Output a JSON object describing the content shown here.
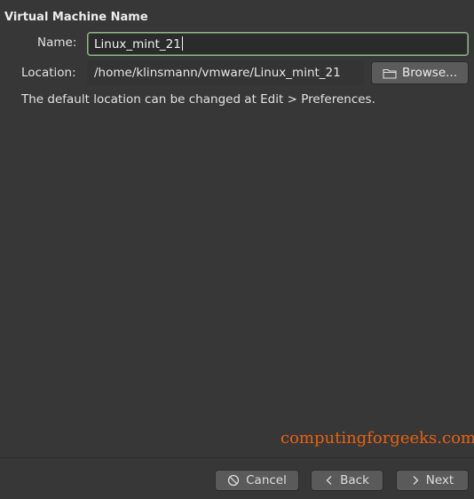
{
  "section": {
    "title": "Virtual Machine Name"
  },
  "name_row": {
    "label": "Name:",
    "value": "Linux_mint_21"
  },
  "location_row": {
    "label": "Location:",
    "value": "/home/klinsmann/vmware/Linux_mint_21",
    "browse_label": "Browse..."
  },
  "info": {
    "text": "The default location can be changed at Edit > Preferences."
  },
  "watermark": {
    "text": "computingforgeeks.com",
    "color": "#e8620f"
  },
  "footer": {
    "cancel_label": "Cancel",
    "back_label": "Back",
    "next_label": "Next"
  },
  "icons": {
    "browse": "folder-icon",
    "cancel": "cancel-circle-icon",
    "back": "chevron-left-icon",
    "next": "chevron-right-icon"
  },
  "colors": {
    "background": "#373737",
    "focus_border": "#93b58b",
    "button": "#5a5a5a"
  }
}
